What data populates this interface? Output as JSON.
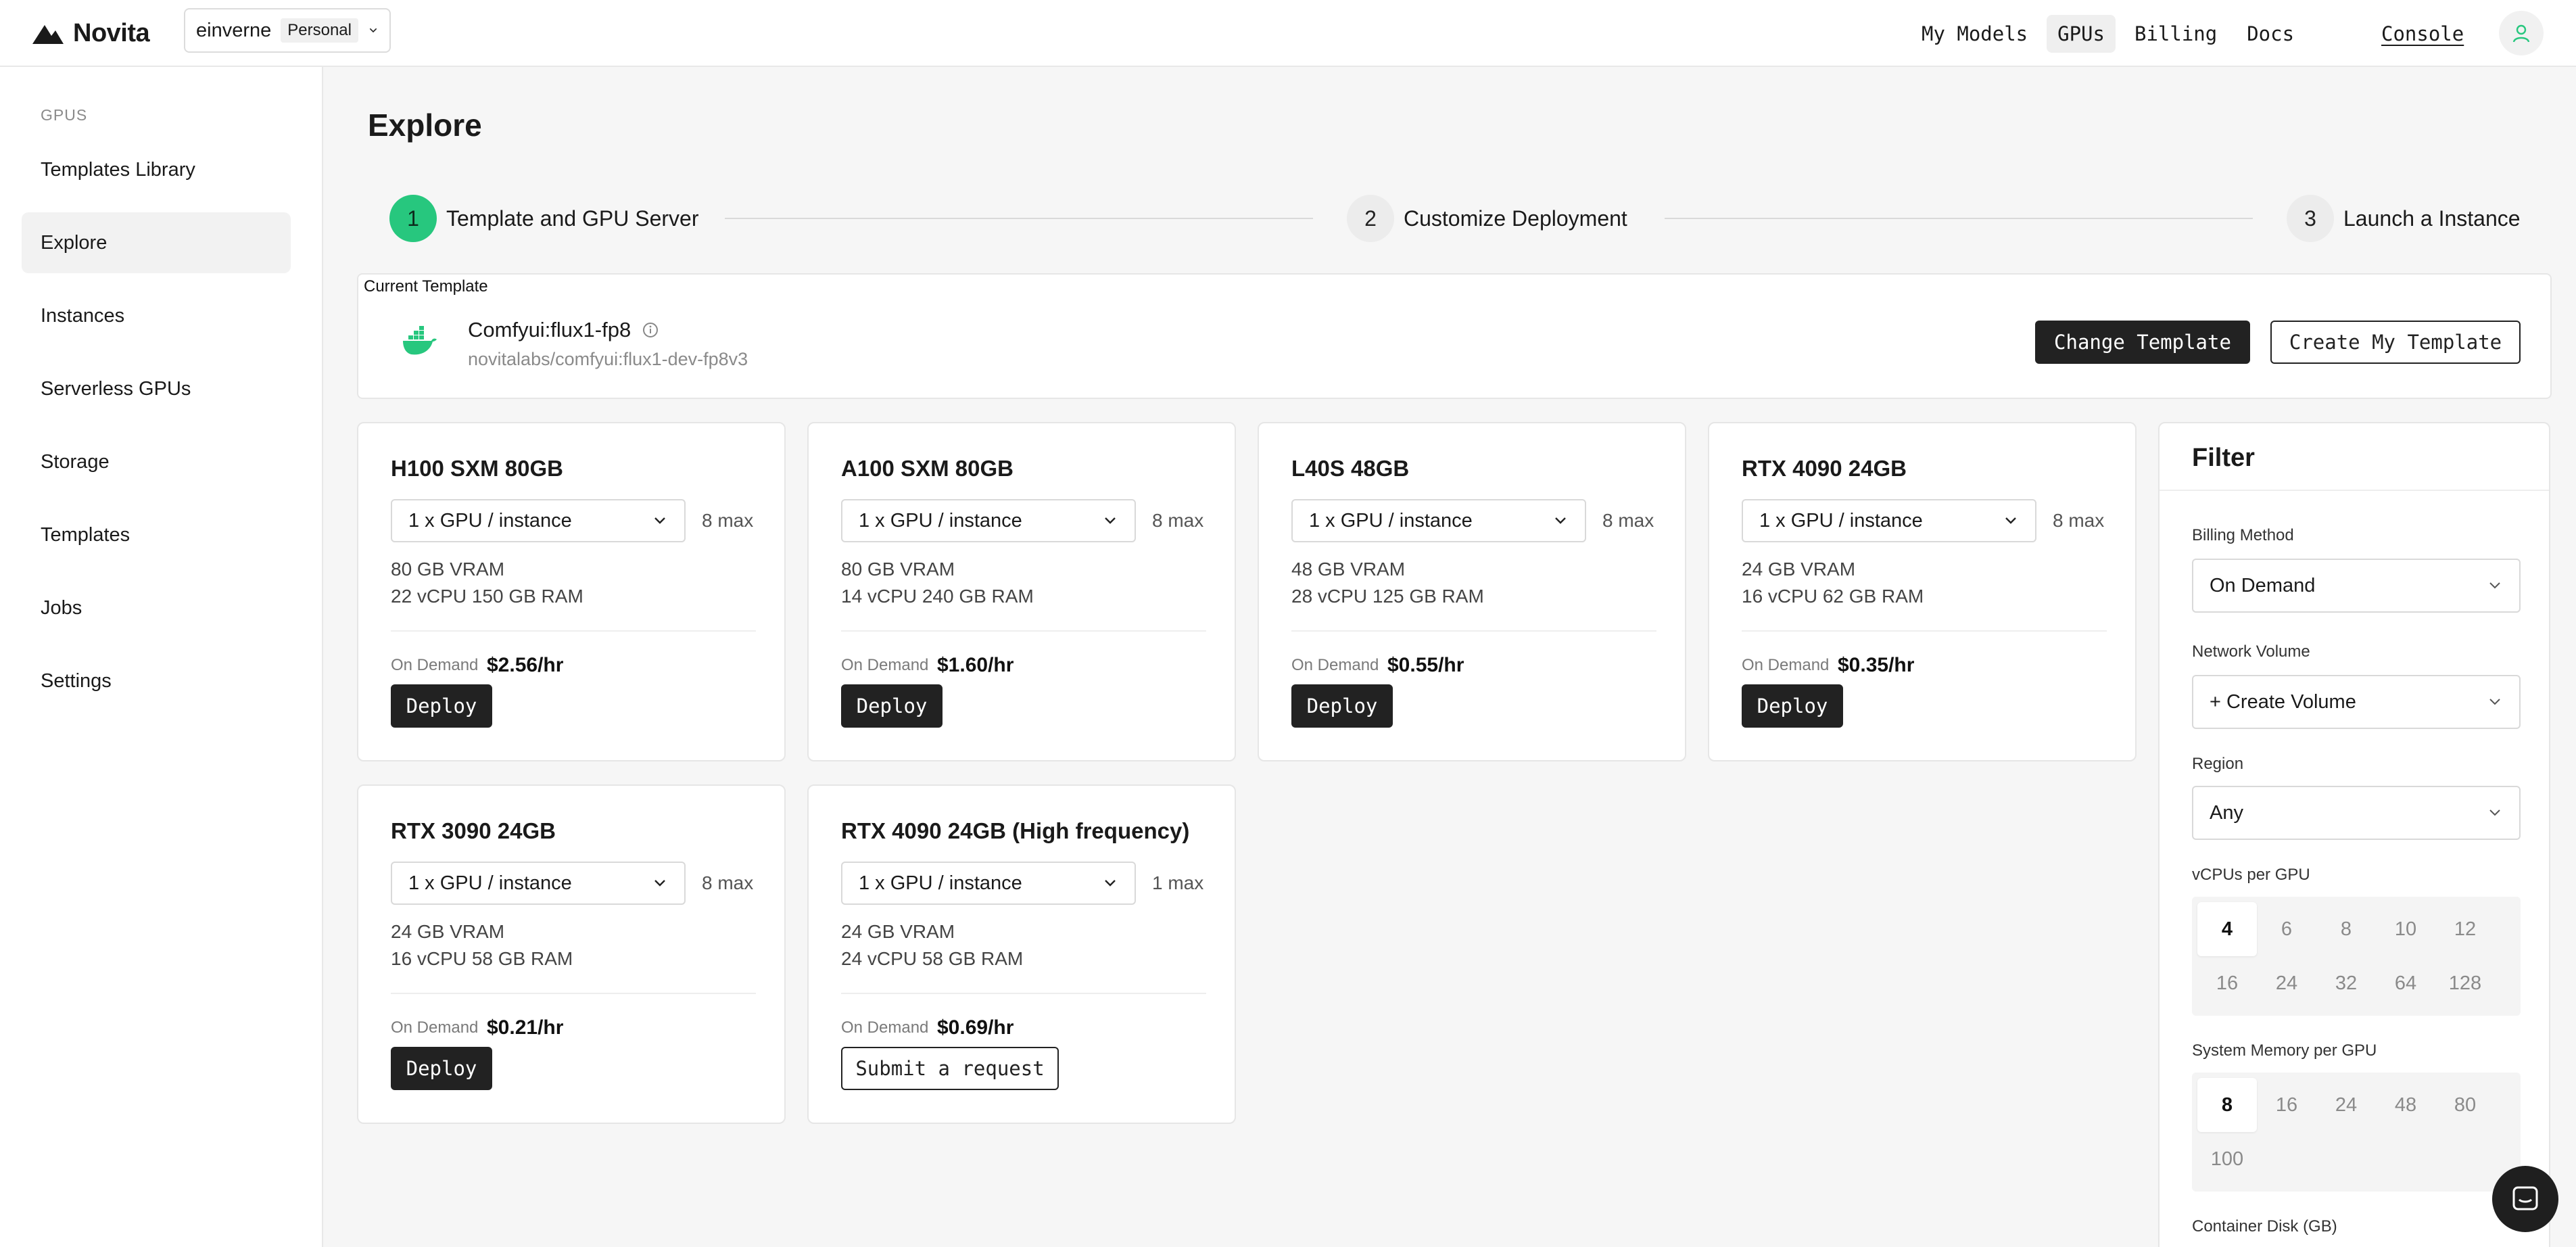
{
  "brand": {
    "name": "Novita",
    "accent": "#27c77e"
  },
  "workspace": {
    "name": "einverne",
    "badge": "Personal"
  },
  "nav": {
    "items": [
      {
        "label": "My Models",
        "active": false
      },
      {
        "label": "GPUs",
        "active": true
      },
      {
        "label": "Billing",
        "active": false
      },
      {
        "label": "Docs",
        "active": false
      }
    ],
    "console": "Console"
  },
  "sidebar": {
    "section": "GPUS",
    "items": [
      {
        "label": "Templates Library",
        "active": false
      },
      {
        "label": "Explore",
        "active": true
      },
      {
        "label": "Instances",
        "active": false
      },
      {
        "label": "Serverless GPUs",
        "active": false
      },
      {
        "label": "Storage",
        "active": false
      },
      {
        "label": "Templates",
        "active": false
      },
      {
        "label": "Jobs",
        "active": false
      },
      {
        "label": "Settings",
        "active": false
      }
    ]
  },
  "page": {
    "title": "Explore"
  },
  "stepper": {
    "steps": [
      {
        "num": "1",
        "label": "Template and GPU Server",
        "active": true
      },
      {
        "num": "2",
        "label": "Customize Deployment",
        "active": false
      },
      {
        "num": "3",
        "label": "Launch a Instance",
        "active": false
      }
    ]
  },
  "template": {
    "label": "Current Template",
    "name": "Comfyui:flux1-fp8",
    "image": "novitalabs/comfyui:flux1-dev-fp8v3",
    "change_label": "Change Template",
    "create_label": "Create My Template"
  },
  "gpus": [
    {
      "name": "H100 SXM 80GB",
      "select": "1 x GPU / instance",
      "max": "8 max",
      "vram": "80 GB VRAM",
      "spec": "22 vCPU 150 GB RAM",
      "billing": "On Demand",
      "price": "$2.56/hr",
      "action": "Deploy",
      "action_type": "deploy"
    },
    {
      "name": "A100 SXM 80GB",
      "select": "1 x GPU / instance",
      "max": "8 max",
      "vram": "80 GB VRAM",
      "spec": "14 vCPU 240 GB RAM",
      "billing": "On Demand",
      "price": "$1.60/hr",
      "action": "Deploy",
      "action_type": "deploy"
    },
    {
      "name": "L40S 48GB",
      "select": "1 x GPU / instance",
      "max": "8 max",
      "vram": "48 GB VRAM",
      "spec": "28 vCPU 125 GB RAM",
      "billing": "On Demand",
      "price": "$0.55/hr",
      "action": "Deploy",
      "action_type": "deploy"
    },
    {
      "name": "RTX 4090 24GB",
      "select": "1 x GPU / instance",
      "max": "8 max",
      "vram": "24 GB VRAM",
      "spec": "16 vCPU 62 GB RAM",
      "billing": "On Demand",
      "price": "$0.35/hr",
      "action": "Deploy",
      "action_type": "deploy"
    },
    {
      "name": "RTX 3090 24GB",
      "select": "1 x GPU / instance",
      "max": "8 max",
      "vram": "24 GB VRAM",
      "spec": "16 vCPU 58 GB RAM",
      "billing": "On Demand",
      "price": "$0.21/hr",
      "action": "Deploy",
      "action_type": "deploy"
    },
    {
      "name": "RTX 4090 24GB (High frequency)",
      "select": "1 x GPU / instance",
      "max": "1 max",
      "vram": "24 GB VRAM",
      "spec": "24 vCPU 58 GB RAM",
      "billing": "On Demand",
      "price": "$0.69/hr",
      "action": "Submit a request",
      "action_type": "request"
    }
  ],
  "filter": {
    "title": "Filter",
    "billing_label": "Billing Method",
    "billing_value": "On Demand",
    "network_label": "Network Volume",
    "network_value": "+ Create Volume",
    "region_label": "Region",
    "region_value": "Any",
    "vcpu_label": "vCPUs per GPU",
    "vcpu_options": [
      "4",
      "6",
      "8",
      "10",
      "12",
      "16",
      "24",
      "32",
      "64",
      "128"
    ],
    "vcpu_selected": "4",
    "mem_label": "System Memory per GPU",
    "mem_options": [
      "8",
      "16",
      "24",
      "48",
      "80",
      "100"
    ],
    "mem_selected": "8",
    "disk_label": "Container Disk (GB)"
  },
  "icons": {
    "logo": "novita-logo-icon",
    "workspace_chevron": "chevron-down-icon",
    "avatar": "user-icon",
    "template": "docker-whale-icon",
    "info": "info-icon",
    "chat": "chat-icon"
  }
}
